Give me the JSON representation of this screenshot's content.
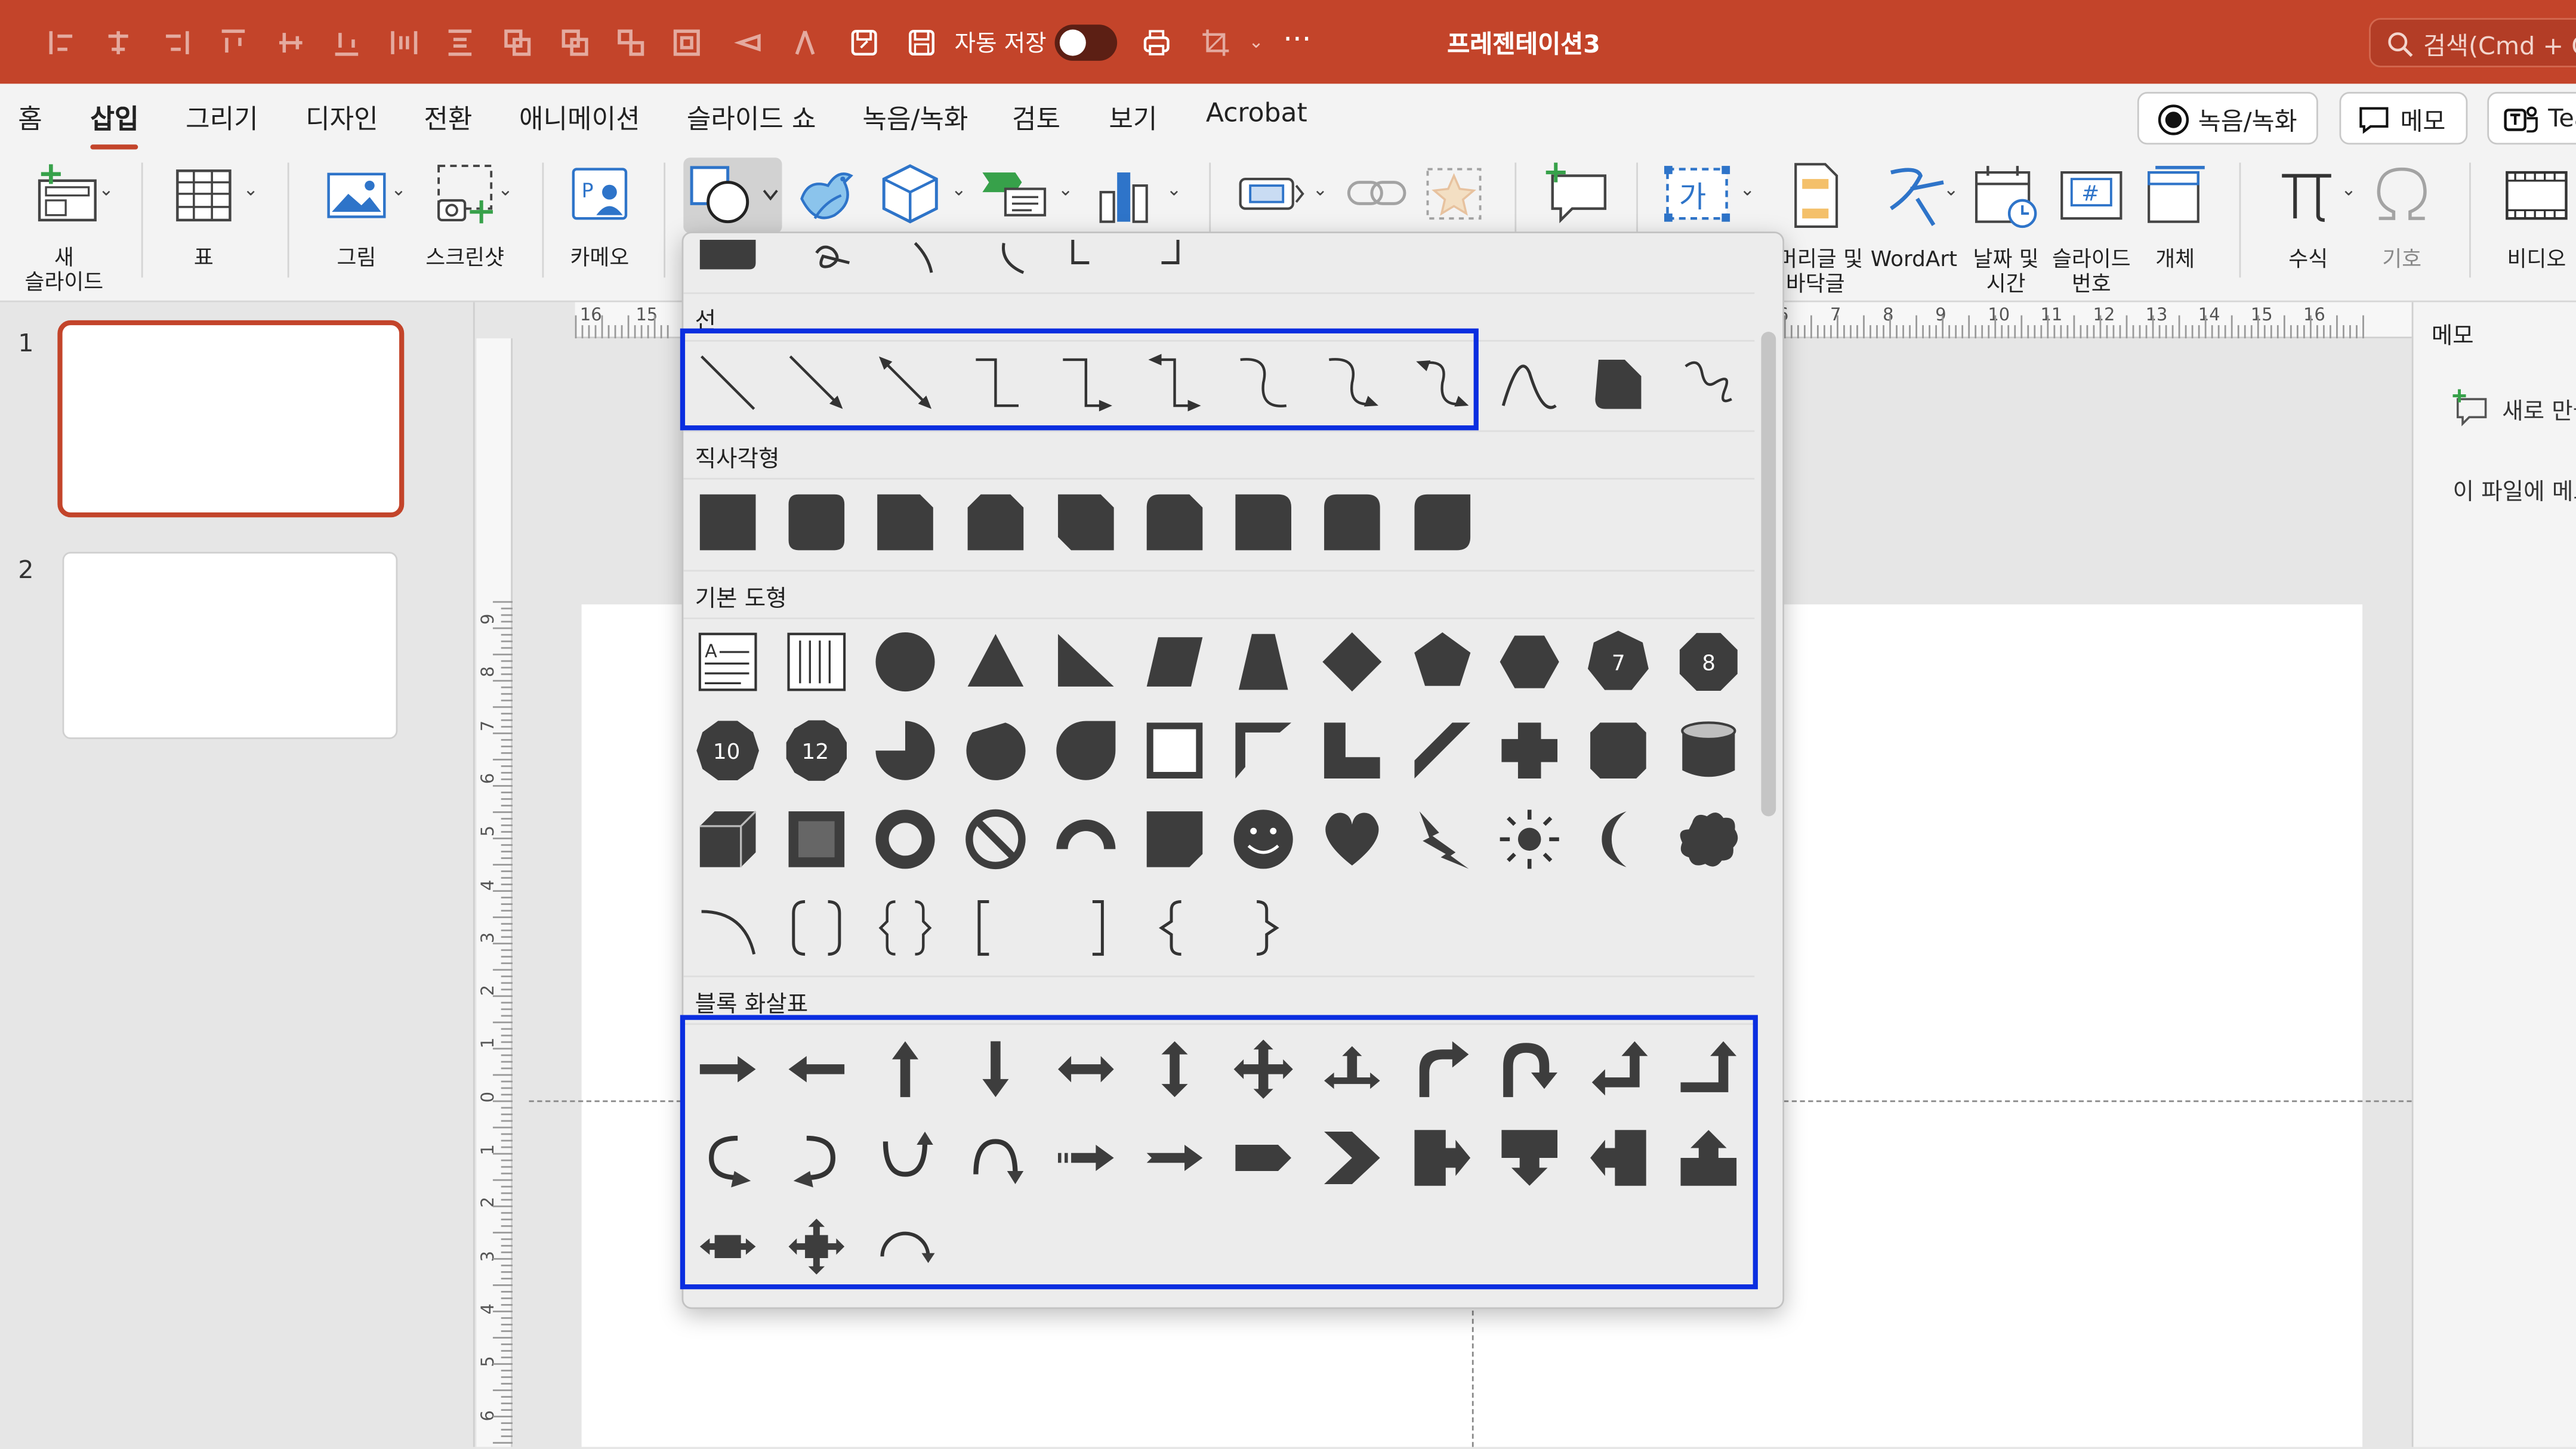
{
  "titlebar": {
    "autosave_label": "자동 저장",
    "doc_title": "프레젠테이션3",
    "search_placeholder": "검색(Cmd + Ctrl"
  },
  "menu": {
    "items": [
      "홈",
      "삽입",
      "그리기",
      "디자인",
      "전환",
      "애니메이션",
      "슬라이드 쇼",
      "녹음/녹화",
      "검토",
      "보기",
      "Acrobat"
    ],
    "active": "삽입",
    "record_button": "녹음/녹화",
    "memo_button": "메모",
    "teams_button": "Teams"
  },
  "ribbon": {
    "new_slide": [
      "새",
      "슬라이드"
    ],
    "table": "표",
    "picture": "그림",
    "screenshot": "스크린샷",
    "cameo": "카메오",
    "header_footer": [
      "머리글 및",
      "바닥글"
    ],
    "wordart": "WordArt",
    "datetime": [
      "날짜 및",
      "시간"
    ],
    "slide_number": [
      "슬라이드",
      "번호"
    ],
    "object": "개체",
    "equation": "수식",
    "symbol": "기호",
    "video": "비디오",
    "textbox_glyph": "가",
    "slide_number_glyph": "#"
  },
  "slides": {
    "numbers": [
      "1",
      "2"
    ],
    "selected": 1
  },
  "right_panel": {
    "title": "메모",
    "new_label": "새로 만들기",
    "empty_text": "이 파일에 메모가 없습니다."
  },
  "rulers": {
    "h_left": [
      "16",
      "15"
    ],
    "h_right": [
      "6",
      "7",
      "8",
      "9",
      "10",
      "11",
      "12",
      "13",
      "14",
      "15",
      "16"
    ],
    "v": [
      "9",
      "8",
      "7",
      "6",
      "5",
      "4",
      "3",
      "2",
      "1",
      "0",
      "1",
      "2",
      "3",
      "4",
      "5",
      "6"
    ]
  },
  "shapes_gallery": {
    "sections": {
      "lines": "선",
      "rectangles": "직사각형",
      "basic": "기본 도형",
      "block_arrows": "블록 화살표"
    },
    "line_shapes": [
      "line",
      "line-arrow",
      "line-double-arrow",
      "elbow-connector",
      "elbow-arrow",
      "elbow-double-arrow",
      "curved-connector",
      "curved-arrow",
      "curved-double-arrow",
      "curve",
      "freeform-shape",
      "scribble"
    ],
    "rectangle_shapes": [
      "rectangle",
      "rounded-rectangle",
      "snip-single-corner",
      "snip-same-side",
      "snip-diagonal",
      "snip-round-single",
      "round-single-corner",
      "round-same-side",
      "round-diagonal"
    ],
    "basic_shape_labels": {
      "heptagon": "7",
      "octagon": "8",
      "decagon": "10",
      "dodecagon": "12"
    },
    "block_arrow_count": 27
  }
}
